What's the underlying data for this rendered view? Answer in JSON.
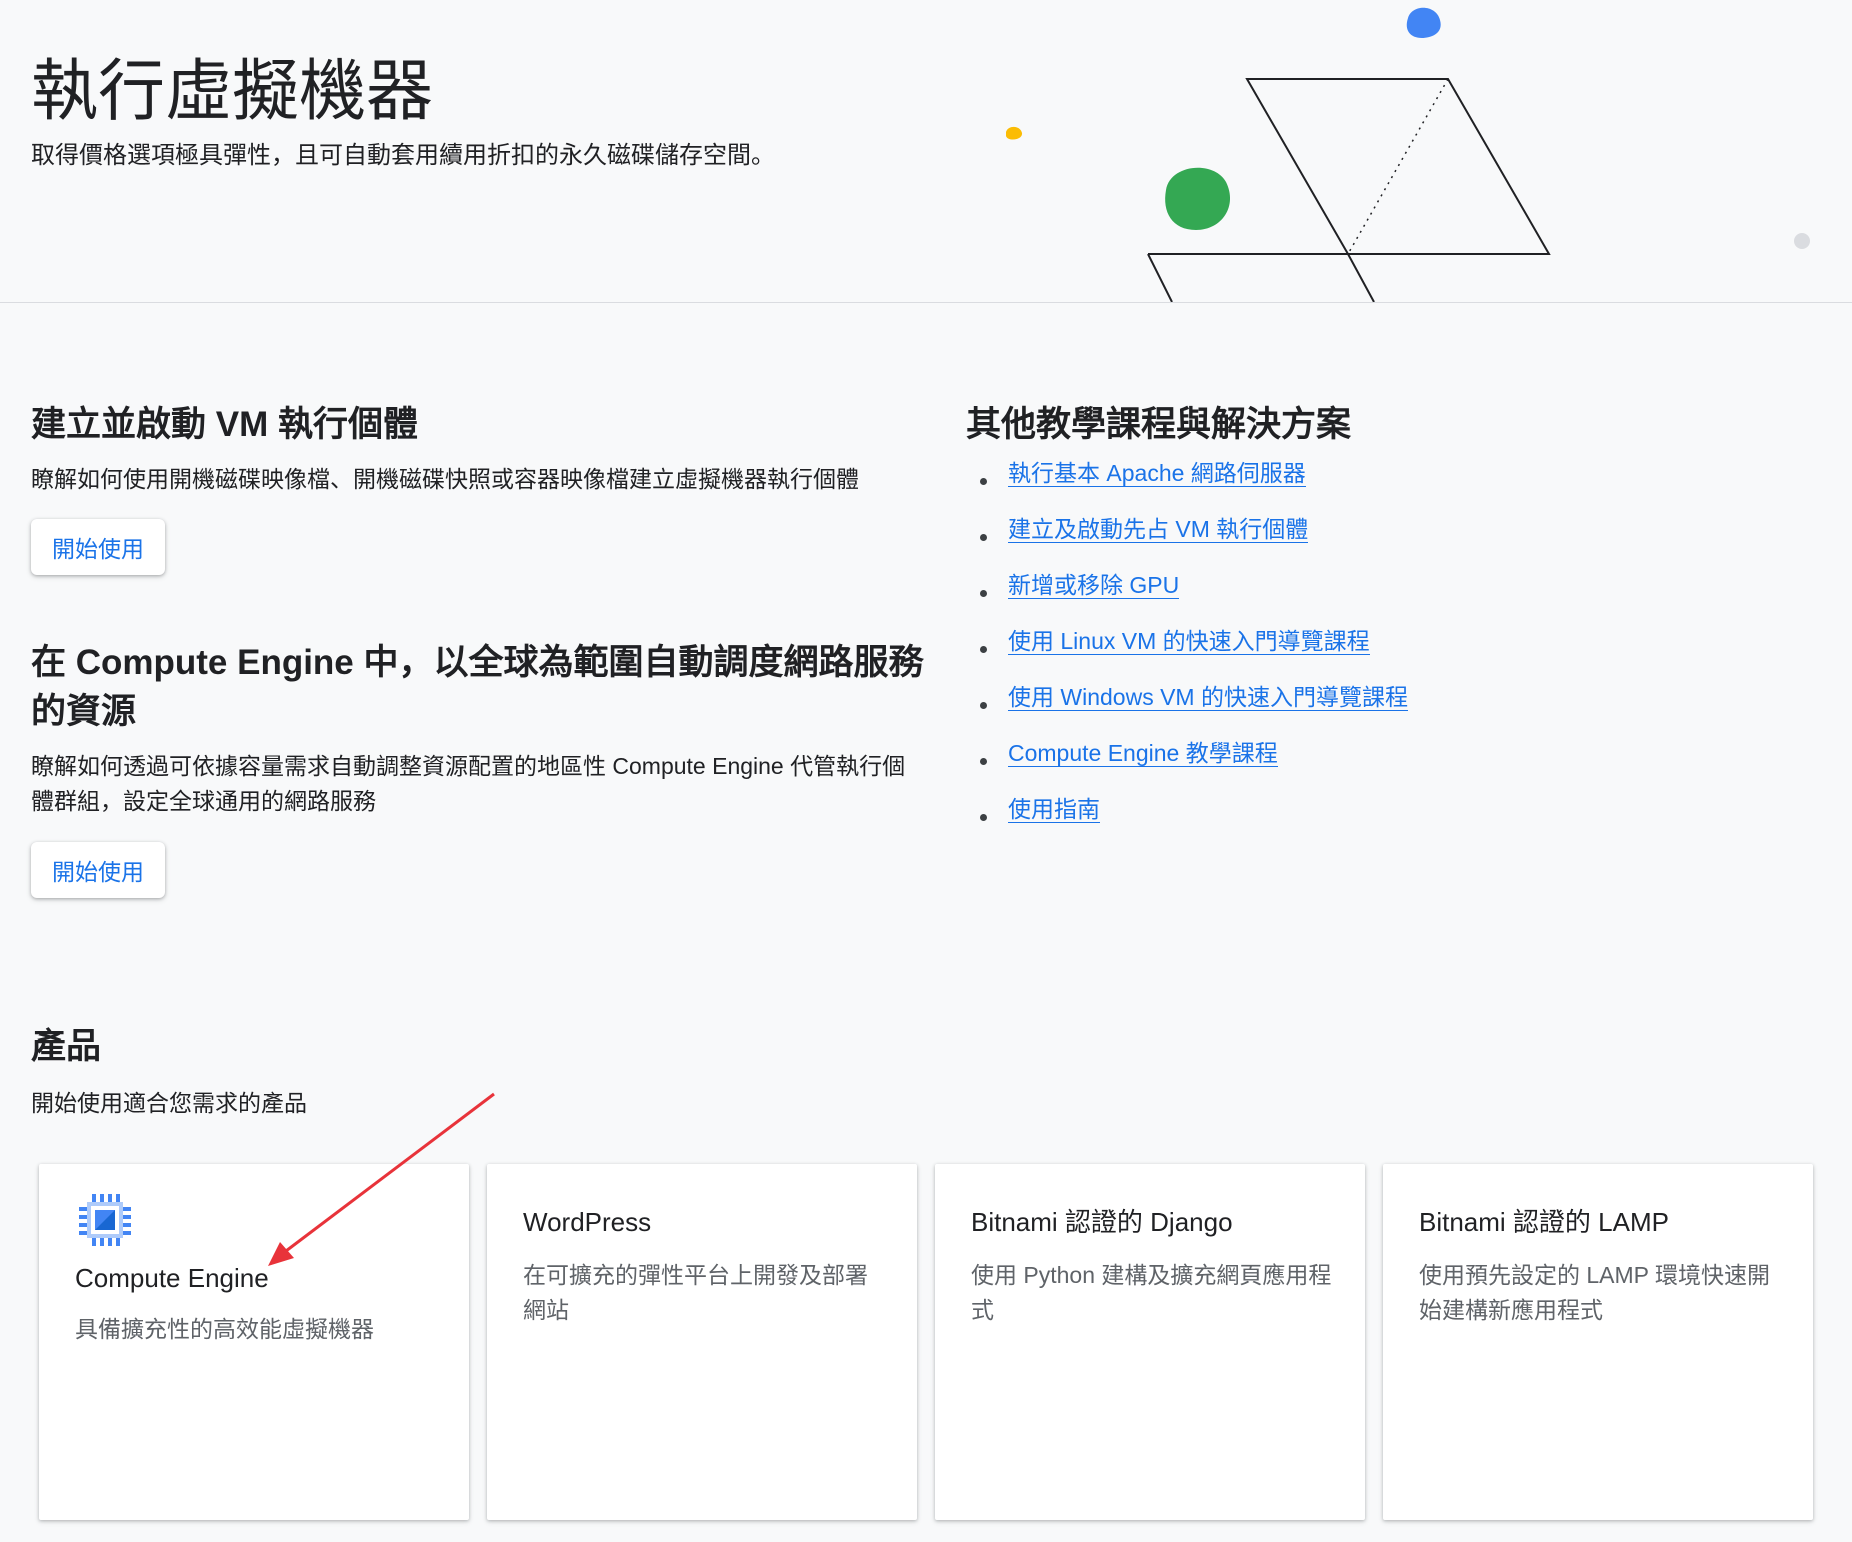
{
  "hero": {
    "title": "執行虛擬機器",
    "subtitle": "取得價格選項極具彈性，且可自動套用續用折扣的永久磁碟儲存空間。"
  },
  "left": {
    "section1": {
      "title": "建立並啟動 VM 執行個體",
      "description": "瞭解如何使用開機磁碟映像檔、開機磁碟快照或容器映像檔建立虛擬機器執行個體",
      "button": "開始使用"
    },
    "section2": {
      "title_line1": "在 Compute Engine 中，以全球為範圍自動調度網路服務",
      "title_line2": "的資源",
      "description_line1": "瞭解如何透過可依據容量需求自動調整資源配置的地區性 Compute Engine 代管執行個",
      "description_line2": "體群組，設定全球通用的網路服務",
      "button": "開始使用"
    }
  },
  "right": {
    "title": "其他教學課程與解決方案",
    "links": [
      "執行基本 Apache 網路伺服器",
      "建立及啟動先占 VM 執行個體",
      "新增或移除 GPU",
      "使用 Linux VM 的快速入門導覽課程",
      "使用 Windows VM 的快速入門導覽課程",
      "Compute Engine 教學課程",
      "使用指南"
    ]
  },
  "products": {
    "title": "產品",
    "subtitle": "開始使用適合您需求的產品",
    "cards": [
      {
        "title": "Compute Engine",
        "desc_line1": "具備擴充性的高效能虛擬機器",
        "desc_line2": "",
        "icon": "compute-engine-chip-icon"
      },
      {
        "title": "WordPress",
        "desc_line1": "在可擴充的彈性平台上開發及部署",
        "desc_line2": "網站"
      },
      {
        "title": "Bitnami 認證的 Django",
        "desc_line1": "使用 Python 建構及擴充網頁應用程",
        "desc_line2": "式"
      },
      {
        "title": "Bitnami 認證的 LAMP",
        "desc_line1": "使用預先設定的 LAMP 環境快速開",
        "desc_line2": "始建構新應用程式"
      }
    ]
  },
  "colors": {
    "link": "#1a73e8",
    "accent_blue": "#4285f4",
    "accent_green": "#34a853",
    "accent_yellow": "#fbbc04",
    "annotation_arrow": "#e8333a"
  }
}
